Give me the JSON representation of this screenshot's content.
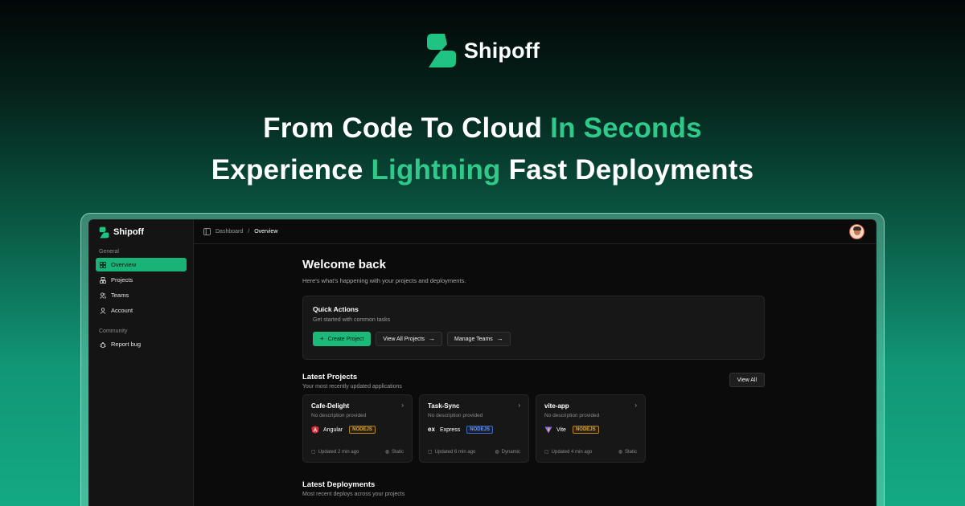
{
  "brand": {
    "name": "Shipoff"
  },
  "headline": {
    "line1": {
      "text": "From Code To Cloud ",
      "accent": "In Seconds"
    },
    "line2": {
      "before": "Experience ",
      "accent": "Lightning",
      "after": " Fast Deployments"
    }
  },
  "colors": {
    "accent": "#2fc98a",
    "active": "#19b377",
    "badge_nodejs": "#e0a83a"
  },
  "app": {
    "brand": "Shipoff",
    "sidebar": {
      "general_label": "General",
      "items": [
        {
          "label": "Overview",
          "icon": "grid-icon"
        },
        {
          "label": "Projects",
          "icon": "boxes-icon"
        },
        {
          "label": "Teams",
          "icon": "users-icon"
        },
        {
          "label": "Account",
          "icon": "user-icon"
        }
      ],
      "community_label": "Community",
      "community_items": [
        {
          "label": "Report bug",
          "icon": "bug-icon"
        }
      ]
    },
    "breadcrumb": {
      "parent": "Dashboard",
      "separator": "/",
      "current": "Overview"
    },
    "welcome": {
      "title": "Welcome back",
      "subtitle": "Here's what's happening with your projects and deployments."
    },
    "quick_actions": {
      "title": "Quick Actions",
      "subtitle": "Get started with common tasks",
      "create": "Create Project",
      "view_projects": "View All Projects",
      "manage_teams": "Manage Teams"
    },
    "latest_projects": {
      "title": "Latest Projects",
      "subtitle": "Your most recently updated applications",
      "view_all": "View All",
      "projects": [
        {
          "name": "Cafe-Delight",
          "description": "No description provided",
          "framework": "Angular",
          "runtime": "NODEJS",
          "updated": "Updated 2 min ago",
          "type": "Static"
        },
        {
          "name": "Task-Sync",
          "description": "No description provided",
          "framework": "Express",
          "runtime": "NODEJS",
          "updated": "Updated 6 min ago",
          "type": "Dynamic"
        },
        {
          "name": "vite-app",
          "description": "No description provided",
          "framework": "Vite",
          "runtime": "NODEJS",
          "updated": "Updated 4 min ago",
          "type": "Static"
        }
      ]
    },
    "latest_deployments": {
      "title": "Latest Deployments",
      "subtitle": "Most recent deploys across your projects"
    }
  }
}
